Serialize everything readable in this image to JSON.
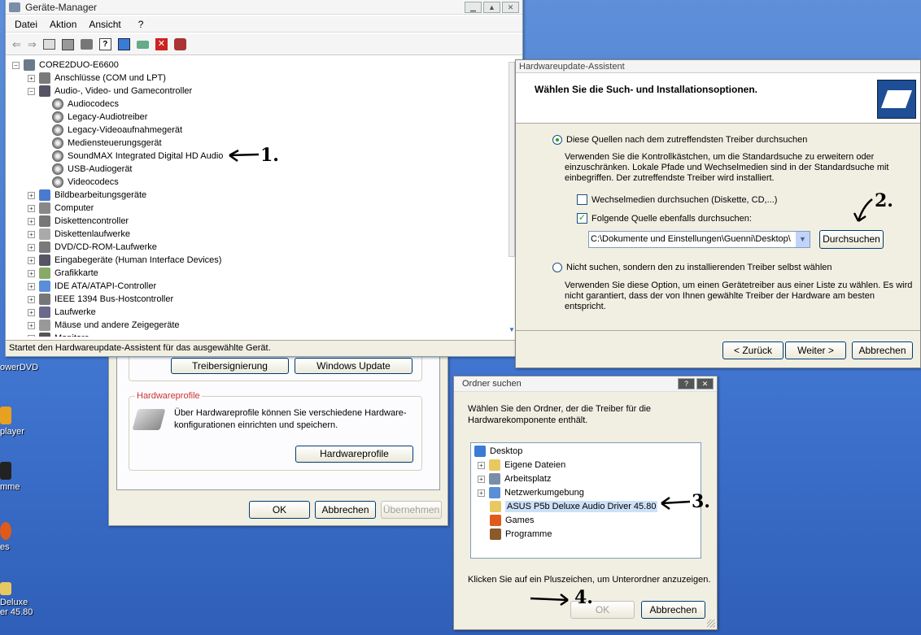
{
  "desktop": {
    "icons": [
      {
        "label": "owerDVD"
      },
      {
        "label": "player"
      },
      {
        "label": "mme"
      },
      {
        "label": "es"
      },
      {
        "label": "Deluxe"
      },
      {
        "label": "er 45.80"
      }
    ]
  },
  "devmgr": {
    "title": "Geräte-Manager",
    "menu": [
      "Datei",
      "Aktion",
      "Ansicht",
      "?"
    ],
    "root": "CORE2DUO-E6600",
    "nodes": [
      {
        "label": "Anschlüsse (COM und LPT)",
        "pm": "+"
      },
      {
        "label": "Audio-, Video- und Gamecontroller",
        "pm": "−"
      },
      {
        "label": "Audiocodecs",
        "child": true
      },
      {
        "label": "Legacy-Audiotreiber",
        "child": true
      },
      {
        "label": "Legacy-Videoaufnahmegerät",
        "child": true
      },
      {
        "label": "Mediensteuerungsgerät",
        "child": true
      },
      {
        "label": "SoundMAX Integrated Digital HD Audio",
        "child": true
      },
      {
        "label": "USB-Audiogerät",
        "child": true
      },
      {
        "label": "Videocodecs",
        "child": true
      },
      {
        "label": "Bildbearbeitungsgeräte",
        "pm": "+"
      },
      {
        "label": "Computer",
        "pm": "+"
      },
      {
        "label": "Diskettencontroller",
        "pm": "+"
      },
      {
        "label": "Diskettenlaufwerke",
        "pm": "+"
      },
      {
        "label": "DVD/CD-ROM-Laufwerke",
        "pm": "+"
      },
      {
        "label": "Eingabegeräte (Human Interface Devices)",
        "pm": "+"
      },
      {
        "label": "Grafikkarte",
        "pm": "+"
      },
      {
        "label": "IDE ATA/ATAPI-Controller",
        "pm": "+"
      },
      {
        "label": "IEEE 1394 Bus-Hostcontroller",
        "pm": "+"
      },
      {
        "label": "Laufwerke",
        "pm": "+"
      },
      {
        "label": "Mäuse und andere Zeigegeräte",
        "pm": "+"
      },
      {
        "label": "Monitore",
        "pm": "+"
      }
    ],
    "status": "Startet den Hardwareupdate-Assistent für das ausgewählte Gerät."
  },
  "sysprops": {
    "btn_treibersignierung": "Treibersignierung",
    "btn_windows_update": "Windows Update",
    "group_hwprofile": "Hardwareprofile",
    "hwprofile_text": "Über Hardwareprofile können Sie verschiedene Hardware-konfigurationen einrichten und speichern.",
    "btn_hardwareprofile": "Hardwareprofile",
    "btn_ok": "OK",
    "btn_abbrechen": "Abbrechen",
    "btn_uebernehmen": "Übernehmen"
  },
  "wizard": {
    "title": "Hardwareupdate-Assistent",
    "heading": "Wählen Sie die Such- und Installationsoptionen.",
    "opt1": "Diese Quellen nach dem zutreffendsten Treiber durchsuchen",
    "opt1_desc": "Verwenden Sie die Kontrollkästchen, um die Standardsuche zu erweitern oder einzuschränken. Lokale Pfade und Wechselmedien sind in der Standardsuche mit einbegriffen. Der zutreffendste Treiber wird installiert.",
    "chk_removable": "Wechselmedien durchsuchen (Diskette, CD,...)",
    "chk_location": "Folgende Quelle ebenfalls durchsuchen:",
    "path": "C:\\Dokumente und Einstellungen\\Guenni\\Desktop\\",
    "btn_browse": "Durchsuchen",
    "opt2": "Nicht suchen, sondern den zu installierenden Treiber selbst wählen",
    "opt2_desc": "Verwenden Sie diese Option, um einen Gerätetreiber aus einer Liste zu wählen. Es wird nicht garantiert, dass der von Ihnen gewählte Treiber der Hardware am besten entspricht.",
    "btn_back": "< Zurück",
    "btn_next": "Weiter >",
    "btn_cancel": "Abbrechen"
  },
  "folder": {
    "title": "Ordner suchen",
    "desc": "Wählen Sie den Ordner, der die Treiber für die Hardwarekomponente enthält.",
    "items": [
      {
        "label": "Desktop"
      },
      {
        "label": "Eigene Dateien"
      },
      {
        "label": "Arbeitsplatz"
      },
      {
        "label": "Netzwerkumgebung"
      },
      {
        "label": "ASUS P5b Deluxe Audio Driver 45.80"
      },
      {
        "label": "Games"
      },
      {
        "label": "Programme"
      }
    ],
    "hint": "Klicken Sie auf ein Pluszeichen, um Unterordner anzuzeigen.",
    "btn_ok": "OK",
    "btn_cancel": "Abbrechen"
  },
  "annotations": [
    "1.",
    "2.",
    "3.",
    "4."
  ]
}
